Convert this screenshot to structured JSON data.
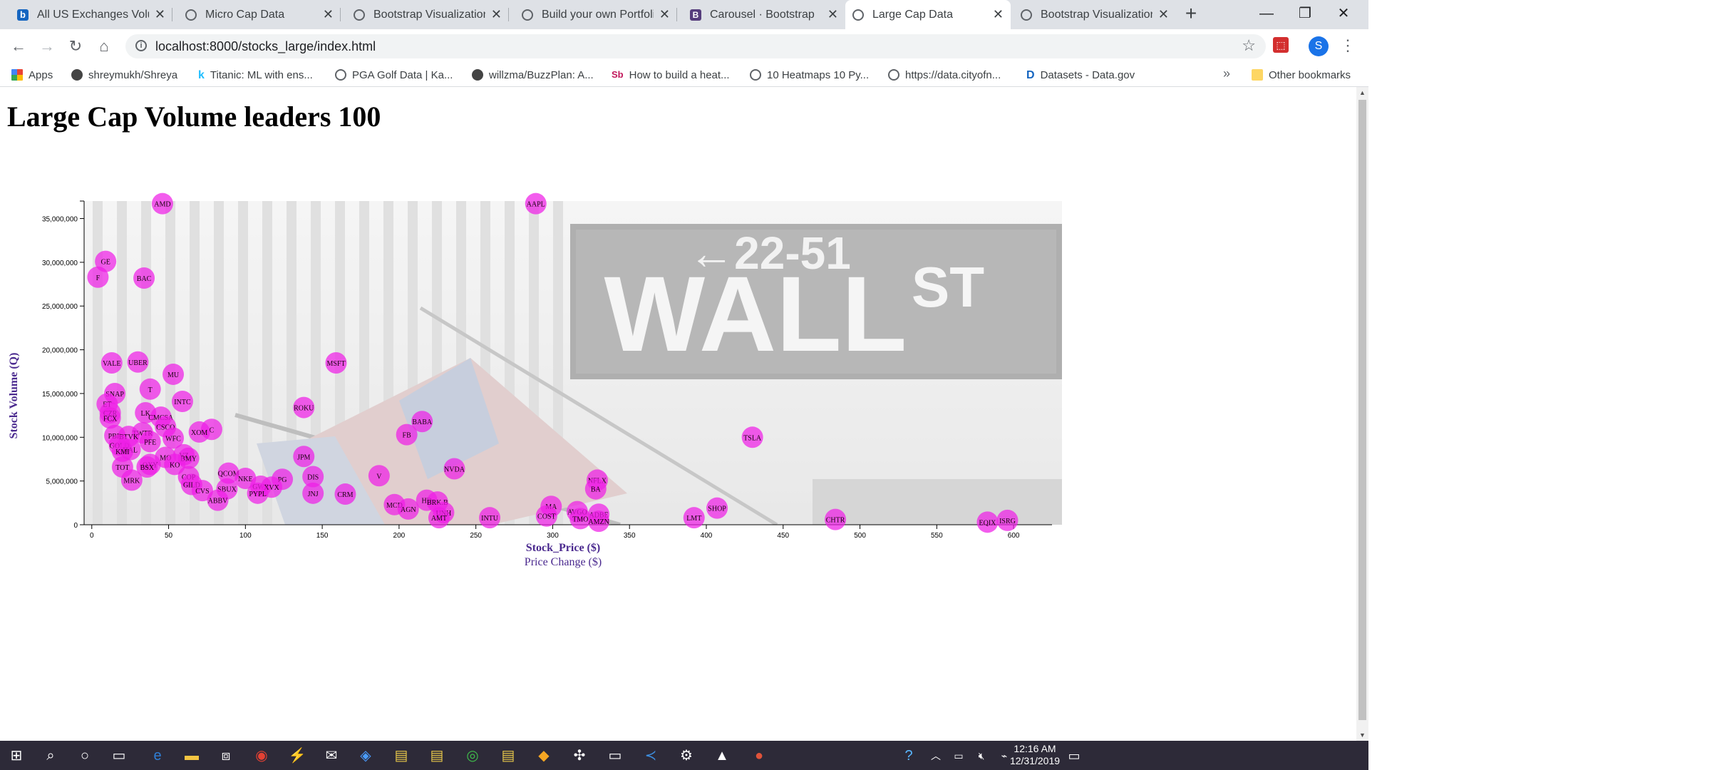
{
  "browser": {
    "tabs": [
      {
        "title": "All US Exchanges Volu",
        "icon": "b-favicon"
      },
      {
        "title": "Micro Cap Data",
        "icon": "globe-icon"
      },
      {
        "title": "Bootstrap Visualization",
        "icon": "globe-icon"
      },
      {
        "title": "Build your own Portfoli",
        "icon": "globe-icon"
      },
      {
        "title": "Carousel · Bootstrap",
        "icon": "bootstrap-favicon"
      },
      {
        "title": "Large Cap Data",
        "icon": "globe-icon",
        "active": true
      },
      {
        "title": "Bootstrap Visualization",
        "icon": "globe-icon"
      }
    ],
    "url": "localhost:8000/stocks_large/index.html",
    "bookmarks": [
      {
        "label": "Apps",
        "icon": "apps-icon"
      },
      {
        "label": "shreymukh/Shreya",
        "icon": "github-icon"
      },
      {
        "label": "Titanic: ML with ens...",
        "icon": "kaggle-icon"
      },
      {
        "label": "PGA Golf Data | Ka...",
        "icon": "globe-icon"
      },
      {
        "label": "willzma/BuzzPlan: A...",
        "icon": "github-icon"
      },
      {
        "label": "How to build a heat...",
        "icon": "sb-icon"
      },
      {
        "label": "10 Heatmaps 10 Py...",
        "icon": "globe-icon"
      },
      {
        "label": "https://data.cityofn...",
        "icon": "globe-icon"
      },
      {
        "label": "Datasets - Data.gov",
        "icon": "datagov-icon"
      }
    ],
    "other_bookmarks": "Other bookmarks",
    "profile_initial": "S",
    "new_tab": "+",
    "more_bookmarks": "»"
  },
  "page": {
    "title": "Large Cap Volume leaders 100"
  },
  "chart_data": {
    "type": "scatter",
    "xlabel": "Stock_Price ($)",
    "xlabel_alt": "Price Change ($)",
    "ylabel": "Stock Volume (Q)",
    "xlim": [
      -5,
      625
    ],
    "ylim": [
      0,
      37000000
    ],
    "xticks": [
      0,
      50,
      100,
      150,
      200,
      250,
      300,
      350,
      400,
      450,
      500,
      550,
      600
    ],
    "yticks": [
      0,
      5000000,
      10000000,
      15000000,
      20000000,
      25000000,
      30000000,
      35000000
    ],
    "ytick_labels": [
      "0",
      "5,000,000",
      "10,000,000",
      "15,000,000",
      "20,000,000",
      "25,000,000",
      "30,000,000",
      "35,000,000"
    ],
    "marker_color": "#ee1ee6",
    "background_image": "new-york-stock-exchange-wall-st-photo",
    "points": [
      {
        "t": "AMD",
        "x": 46,
        "y": 36700000
      },
      {
        "t": "AAPL",
        "x": 289,
        "y": 36700000
      },
      {
        "t": "GE",
        "x": 9,
        "y": 30100000
      },
      {
        "t": "F",
        "x": 4,
        "y": 28300000
      },
      {
        "t": "BAC",
        "x": 34,
        "y": 28200000
      },
      {
        "t": "VALE",
        "x": 13,
        "y": 18500000
      },
      {
        "t": "UBER",
        "x": 30,
        "y": 18600000
      },
      {
        "t": "MSFT",
        "x": 159,
        "y": 18500000
      },
      {
        "t": "MU",
        "x": 53,
        "y": 17200000
      },
      {
        "t": "T",
        "x": 38,
        "y": 15500000
      },
      {
        "t": "SNAP",
        "x": 15,
        "y": 15000000
      },
      {
        "t": "INTC",
        "x": 59,
        "y": 14100000
      },
      {
        "t": "ROKU",
        "x": 138,
        "y": 13400000
      },
      {
        "t": "ET",
        "x": 10,
        "y": 13800000
      },
      {
        "t": "LK",
        "x": 35,
        "y": 12800000
      },
      {
        "t": "CZR",
        "x": 12,
        "y": 12800000
      },
      {
        "t": "FCX",
        "x": 12,
        "y": 12200000
      },
      {
        "t": "CMCSA",
        "x": 45,
        "y": 12300000
      },
      {
        "t": "BABA",
        "x": 215,
        "y": 11800000
      },
      {
        "t": "CSCO",
        "x": 48,
        "y": 11200000
      },
      {
        "t": "C",
        "x": 78,
        "y": 10900000
      },
      {
        "t": "XOM",
        "x": 70,
        "y": 10600000
      },
      {
        "t": "TWTR",
        "x": 33,
        "y": 10500000
      },
      {
        "t": "FB",
        "x": 205,
        "y": 10300000
      },
      {
        "t": "TSLA",
        "x": 430,
        "y": 10000000
      },
      {
        "t": "PBR",
        "x": 15,
        "y": 10200000
      },
      {
        "t": "BTVK",
        "x": 24,
        "y": 10100000
      },
      {
        "t": "WFC",
        "x": 53,
        "y": 9900000
      },
      {
        "t": "PFE",
        "x": 38,
        "y": 9500000
      },
      {
        "t": "GOLD",
        "x": 18,
        "y": 9100000
      },
      {
        "t": "HAL",
        "x": 25,
        "y": 8600000
      },
      {
        "t": "KMI",
        "x": 20,
        "y": 8400000
      },
      {
        "t": "MO",
        "x": 48,
        "y": 7700000
      },
      {
        "t": "VZ",
        "x": 60,
        "y": 8000000
      },
      {
        "t": "JPM",
        "x": 138,
        "y": 7800000
      },
      {
        "t": "BMY",
        "x": 63,
        "y": 7600000
      },
      {
        "t": "KO",
        "x": 54,
        "y": 6900000
      },
      {
        "t": "OXY",
        "x": 38,
        "y": 6900000
      },
      {
        "t": "BSX",
        "x": 36,
        "y": 6600000
      },
      {
        "t": "NVDA",
        "x": 236,
        "y": 6400000
      },
      {
        "t": "TOT",
        "x": 20,
        "y": 6600000
      },
      {
        "t": "QCOM",
        "x": 89,
        "y": 5900000
      },
      {
        "t": "V",
        "x": 187,
        "y": 5600000
      },
      {
        "t": "DIS",
        "x": 144,
        "y": 5500000
      },
      {
        "t": "COP",
        "x": 63,
        "y": 5500000
      },
      {
        "t": "NKE",
        "x": 100,
        "y": 5300000
      },
      {
        "t": "PG",
        "x": 124,
        "y": 5200000
      },
      {
        "t": "NFLX",
        "x": 329,
        "y": 5100000
      },
      {
        "t": "MRK",
        "x": 26,
        "y": 5100000
      },
      {
        "t": "GILD",
        "x": 65,
        "y": 4600000
      },
      {
        "t": "GWR",
        "x": 110,
        "y": 4400000
      },
      {
        "t": "XVX",
        "x": 117,
        "y": 4300000
      },
      {
        "t": "BA",
        "x": 328,
        "y": 4100000
      },
      {
        "t": "SBUX",
        "x": 88,
        "y": 4100000
      },
      {
        "t": "CVS",
        "x": 72,
        "y": 3900000
      },
      {
        "t": "PYPL",
        "x": 108,
        "y": 3600000
      },
      {
        "t": "JNJ",
        "x": 144,
        "y": 3600000
      },
      {
        "t": "CRM",
        "x": 165,
        "y": 3500000
      },
      {
        "t": "HD",
        "x": 218,
        "y": 2800000
      },
      {
        "t": "BRK.B",
        "x": 225,
        "y": 2600000
      },
      {
        "t": "SHOP",
        "x": 407,
        "y": 1900000
      },
      {
        "t": "MCD",
        "x": 197,
        "y": 2300000
      },
      {
        "t": "MA",
        "x": 299,
        "y": 2100000
      },
      {
        "t": "AGN",
        "x": 206,
        "y": 1800000
      },
      {
        "t": "AVGO",
        "x": 316,
        "y": 1500000
      },
      {
        "t": "ADBE",
        "x": 330,
        "y": 1200000
      },
      {
        "t": "LMT",
        "x": 392,
        "y": 800000
      },
      {
        "t": "CHTR",
        "x": 484,
        "y": 600000
      },
      {
        "t": "EQIX",
        "x": 583,
        "y": 300000
      },
      {
        "t": "ISRG",
        "x": 596,
        "y": 500000
      },
      {
        "t": "UNH",
        "x": 229,
        "y": 1400000
      },
      {
        "t": "TMO",
        "x": 318,
        "y": 700000
      },
      {
        "t": "AMT",
        "x": 226,
        "y": 800000
      },
      {
        "t": "INTU",
        "x": 259,
        "y": 800000
      },
      {
        "t": "COST",
        "x": 296,
        "y": 1000000
      },
      {
        "t": "ABBV",
        "x": 82,
        "y": 2800000
      },
      {
        "t": "AMZN",
        "x": 330,
        "y": 400000
      }
    ]
  },
  "taskbar": {
    "time": "12:16 AM",
    "date": "12/31/2019"
  }
}
